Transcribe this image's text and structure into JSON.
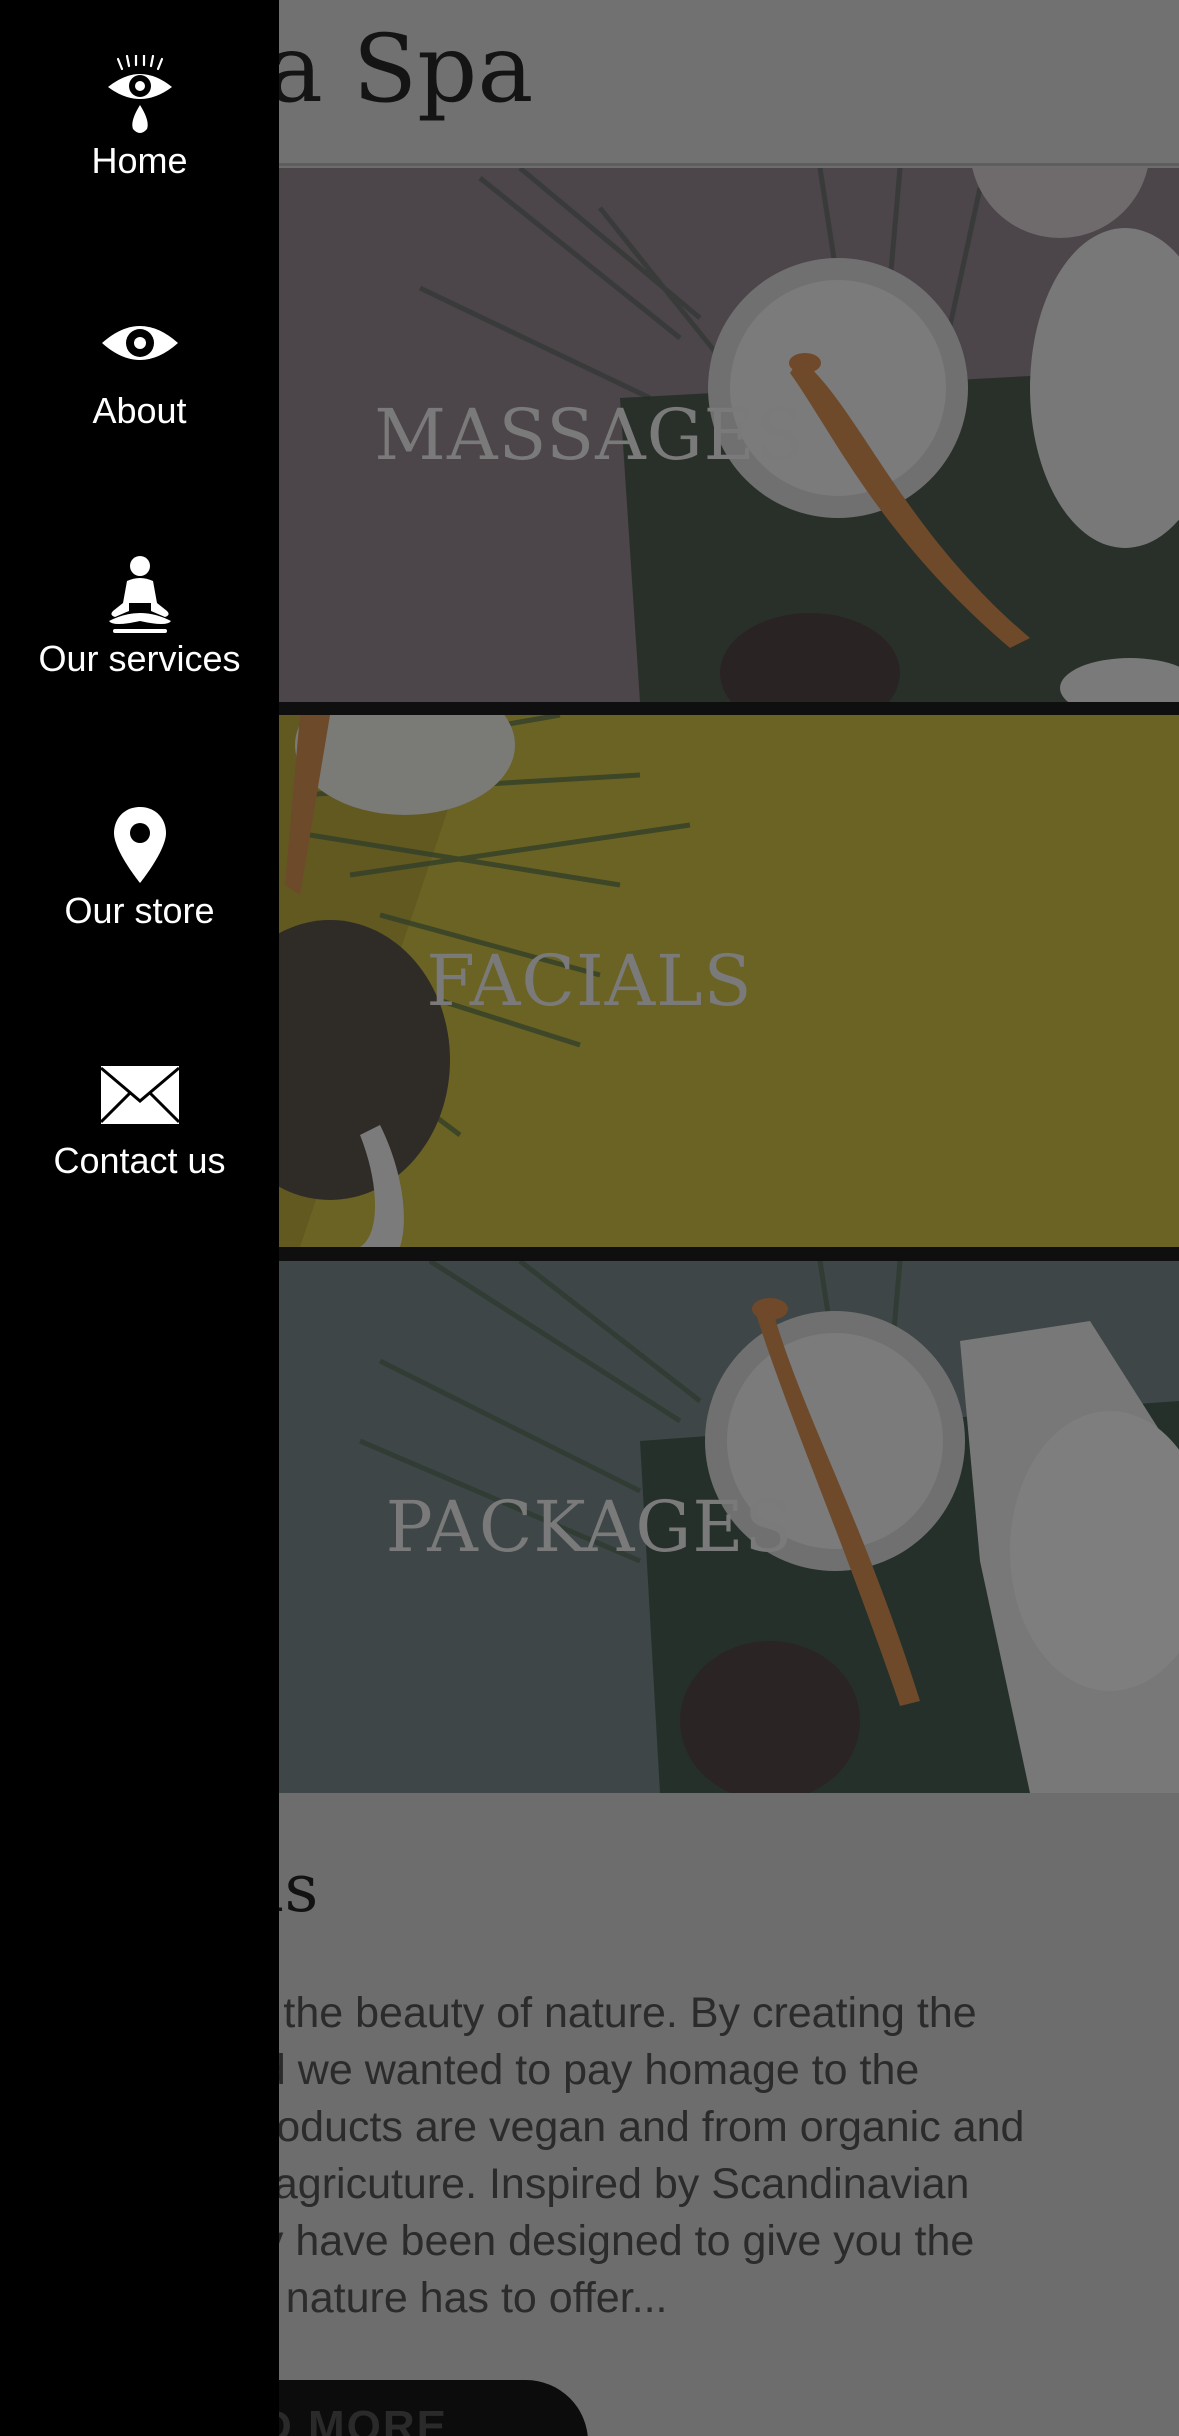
{
  "header": {
    "brand_partial": "eija Spa"
  },
  "services": [
    {
      "label": "MASSAGES"
    },
    {
      "label": "FACIALS"
    },
    {
      "label": "PACKAGES"
    }
  ],
  "about": {
    "heading_partial": "us",
    "text_lines": [
      "in the beauty of nature. By creating the",
      "nd we wanted to pay homage to the",
      "products are vegan and from organic and",
      "e agricuture. Inspired by Scandinavian",
      "ey have been designed to give you the",
      "at nature has to offer..."
    ],
    "button_label_partial": "D MORE"
  },
  "drawer": {
    "items": [
      {
        "label": "Home",
        "icon": "eye-tear-icon"
      },
      {
        "label": "About",
        "icon": "eye-icon"
      },
      {
        "label": "Our services",
        "icon": "meditation-icon"
      },
      {
        "label": "Our store",
        "icon": "location-pin-icon"
      },
      {
        "label": "Contact us",
        "icon": "envelope-icon"
      }
    ]
  },
  "colors": {
    "drawer_bg": "#000000",
    "overlay": "#6d6d6d",
    "facials_tint": "#6a6222"
  }
}
